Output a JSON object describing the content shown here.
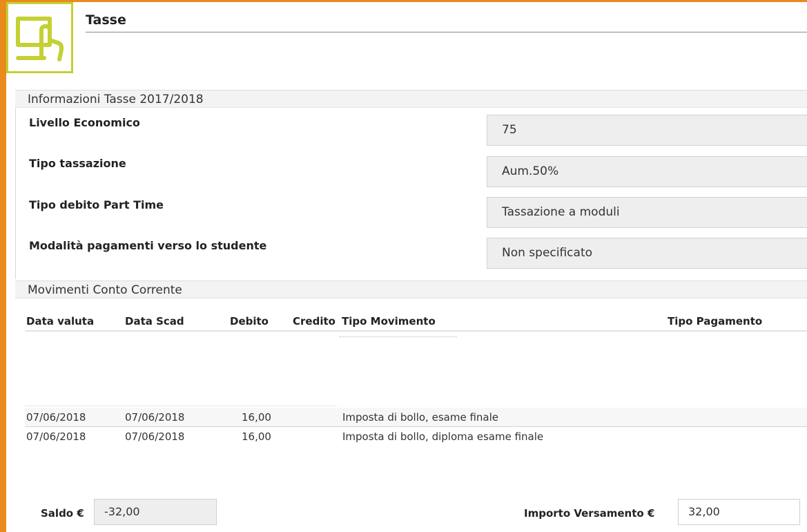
{
  "header": {
    "title": "Tasse",
    "logo_icon": "touch-screen-icon",
    "accent_color": "#c4d034",
    "frame_color": "#e98a1d"
  },
  "info": {
    "section_title": "Informazioni Tasse 2017/2018",
    "fields": [
      {
        "label": "Livello Economico",
        "value": "75"
      },
      {
        "label": "Tipo tassazione",
        "value": "Aum.50%"
      },
      {
        "label": "Tipo debito Part Time",
        "value": "Tassazione a moduli"
      },
      {
        "label": "Modalità pagamenti verso lo studente",
        "value": "Non specificato"
      }
    ]
  },
  "movements": {
    "section_title": "Movimenti Conto Corrente",
    "columns": [
      "Data valuta",
      "Data Scad",
      "Debito",
      "Credito",
      "Tipo Movimento",
      "Tipo Pagamento"
    ],
    "rows": [
      {
        "data_valuta": "07/06/2018",
        "data_scad": "07/06/2018",
        "debito": "16,00",
        "credito": "",
        "tipo_movimento": "Imposta di bollo, esame finale",
        "tipo_pagamento": ""
      },
      {
        "data_valuta": "07/06/2018",
        "data_scad": "07/06/2018",
        "debito": "16,00",
        "credito": "",
        "tipo_movimento": "Imposta di bollo, diploma esame finale",
        "tipo_pagamento": ""
      }
    ]
  },
  "footer": {
    "saldo_label": "Saldo €",
    "saldo_value": "-32,00",
    "importo_label": "Importo Versamento €",
    "importo_value": "32,00"
  }
}
